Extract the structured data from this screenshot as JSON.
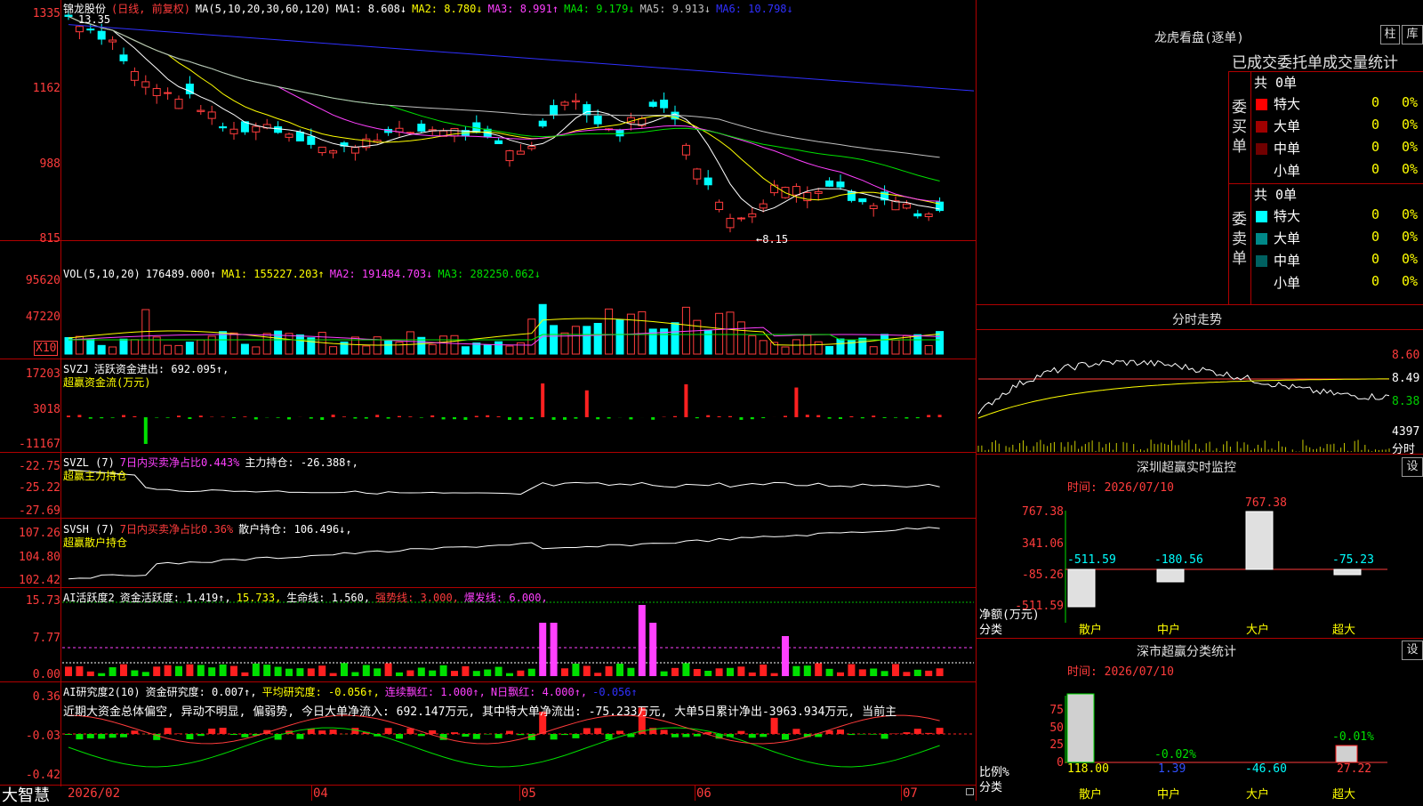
{
  "stock": {
    "name": "锦龙股份",
    "period": "(日线, 前复权)",
    "ma_label": "MA(5,10,20,30,60,120)",
    "ma1": "MA1: 8.608↓",
    "ma2": "MA2: 8.780↓",
    "ma3": "MA3: 8.991↑",
    "ma4": "MA4: 9.179↓",
    "ma5": "MA5: 9.913↓",
    "ma6": "MA6: 10.798↓",
    "high_label": "13.35",
    "low_label": "←8.15"
  },
  "price_axis": [
    "1335",
    "1162",
    "988",
    "815"
  ],
  "vol": {
    "label": "VOL(5,10,20)",
    "value": "176489.000↑",
    "ma1": "MA1: 155227.203↑",
    "ma2": "MA2: 191484.703↓",
    "ma3": "MA3: 282250.062↓",
    "axis": [
      "95620",
      "47220"
    ],
    "unit": "X10"
  },
  "svzj": {
    "label": "SVZJ",
    "line1": "活跃资金进出: 692.095↑,",
    "line2": "超赢资金流(万元)",
    "axis": [
      "17203",
      "3018",
      "-11167"
    ]
  },
  "svzl": {
    "label": "SVZL (7)",
    "pct": "7日内买卖净占比0.443%",
    "main": "主力持仓: -26.388↑,",
    "line2": "超赢主力持仓",
    "axis": [
      "-22.75",
      "-25.22",
      "-27.69"
    ]
  },
  "svsh": {
    "label": "SVSH (7)",
    "pct": "7日内买卖净占比0.36%",
    "retail": "散户持仓: 106.496↓,",
    "line2": "超赢散户持仓",
    "axis": [
      "107.26",
      "104.80",
      "102.42"
    ]
  },
  "ai_active": {
    "label": "AI活跃度2",
    "active": "资金活跃度: 1.419↑,",
    "v2": "15.733,",
    "life": "生命线: 1.560,",
    "strong": "强势线: 3.000,",
    "burst": "爆发线: 6.000,",
    "axis": [
      "15.73",
      "7.77",
      "0.00"
    ]
  },
  "ai_research": {
    "label": "AI研究度2(10)",
    "research": "资金研究度: 0.007↑,",
    "avg": "平均研究度: -0.056↑,",
    "cont": "连续飘红: 1.000↑,",
    "nday": "N日飘红: 4.000↑,",
    "neg": "-0.056↑",
    "text": "近期大资金总体偏空, 异动不明显, 偏弱势, 今日大单净流入: 692.147万元, 其中特大单净流出: -75.233万元, 大单5日累计净出-3963.934万元, 当前主",
    "axis": [
      "0.36",
      "-0.03",
      "-0.42"
    ]
  },
  "time_axis": [
    "2026/02",
    "04",
    "05",
    "06",
    "07"
  ],
  "brand": "大智慧",
  "side": {
    "lhb_title": "龙虎看盘(逐单)",
    "btn_zhu": "柱",
    "btn_biao": "库",
    "table_title": "已成交委托单成交量统计",
    "buy_label": "委买单",
    "sell_label": "委卖单",
    "buy_total": "共 0单",
    "sell_total": "共 0单",
    "buy_rows": [
      {
        "name": "特大",
        "n": "0",
        "p": "0%",
        "color": "#ff0000"
      },
      {
        "name": "大单",
        "n": "0",
        "p": "0%",
        "color": "#a00000"
      },
      {
        "name": "中单",
        "n": "0",
        "p": "0%",
        "color": "#700000"
      },
      {
        "name": "小单",
        "n": "0",
        "p": "0%",
        "color": ""
      }
    ],
    "sell_rows": [
      {
        "name": "特大",
        "n": "0",
        "p": "0%",
        "color": "#00ffff"
      },
      {
        "name": "大单",
        "n": "0",
        "p": "0%",
        "color": "#008888"
      },
      {
        "name": "中单",
        "n": "0",
        "p": "0%",
        "color": "#006060"
      },
      {
        "name": "小单",
        "n": "0",
        "p": "0%",
        "color": ""
      }
    ],
    "intraday_title": "分时走势",
    "intraday_axis": [
      "8.60",
      "8.49",
      "8.38"
    ],
    "intraday_vol": "4397",
    "intraday_tag": "分时",
    "monitor_title": "深圳超赢实时监控",
    "monitor_btn": "设",
    "monitor_time": "时间: 2026/07/10",
    "monitor_axis": [
      "767.38",
      "341.06",
      "-85.26",
      "-511.59"
    ],
    "monitor_values": [
      "-511.59",
      "-180.56",
      "767.38",
      "-75.23"
    ],
    "monitor_ylabel": "净额(万元)",
    "monitor_xlabel": "分类",
    "monitor_cats": [
      "散户",
      "中户",
      "大户",
      "超大"
    ],
    "stat_title": "深市超赢分类统计",
    "stat_btn": "设",
    "stat_time": "时间: 2026/07/10",
    "stat_axis": [
      "75",
      "50",
      "25",
      "0"
    ],
    "stat_pcts": [
      "-0.02%",
      "-0.01%"
    ],
    "stat_values": [
      "118.00",
      "1.39",
      "-46.60",
      "27.22"
    ],
    "stat_ylabel": "比例%",
    "stat_xlabel": "分类",
    "stat_cats": [
      "散户",
      "中户",
      "大户",
      "超大"
    ]
  }
}
